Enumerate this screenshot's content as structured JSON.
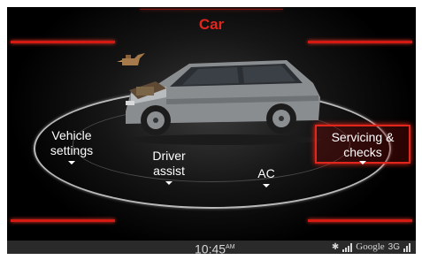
{
  "header": {
    "title": "Car"
  },
  "menu": {
    "vehicle_settings": "Vehicle\nsettings",
    "driver_assist": "Driver\nassist",
    "ac": "AC",
    "servicing_checks": "Servicing &\nchecks"
  },
  "status": {
    "time": "10:45",
    "ampm": "AM",
    "provider": "Google",
    "network": "3G"
  },
  "colors": {
    "accent": "#e0261d",
    "background": "#000000",
    "text": "#ffffff"
  },
  "icons": [
    "bluetooth-icon",
    "signal-icon",
    "network-signal-icon",
    "car-image",
    "oil-can-icon"
  ]
}
